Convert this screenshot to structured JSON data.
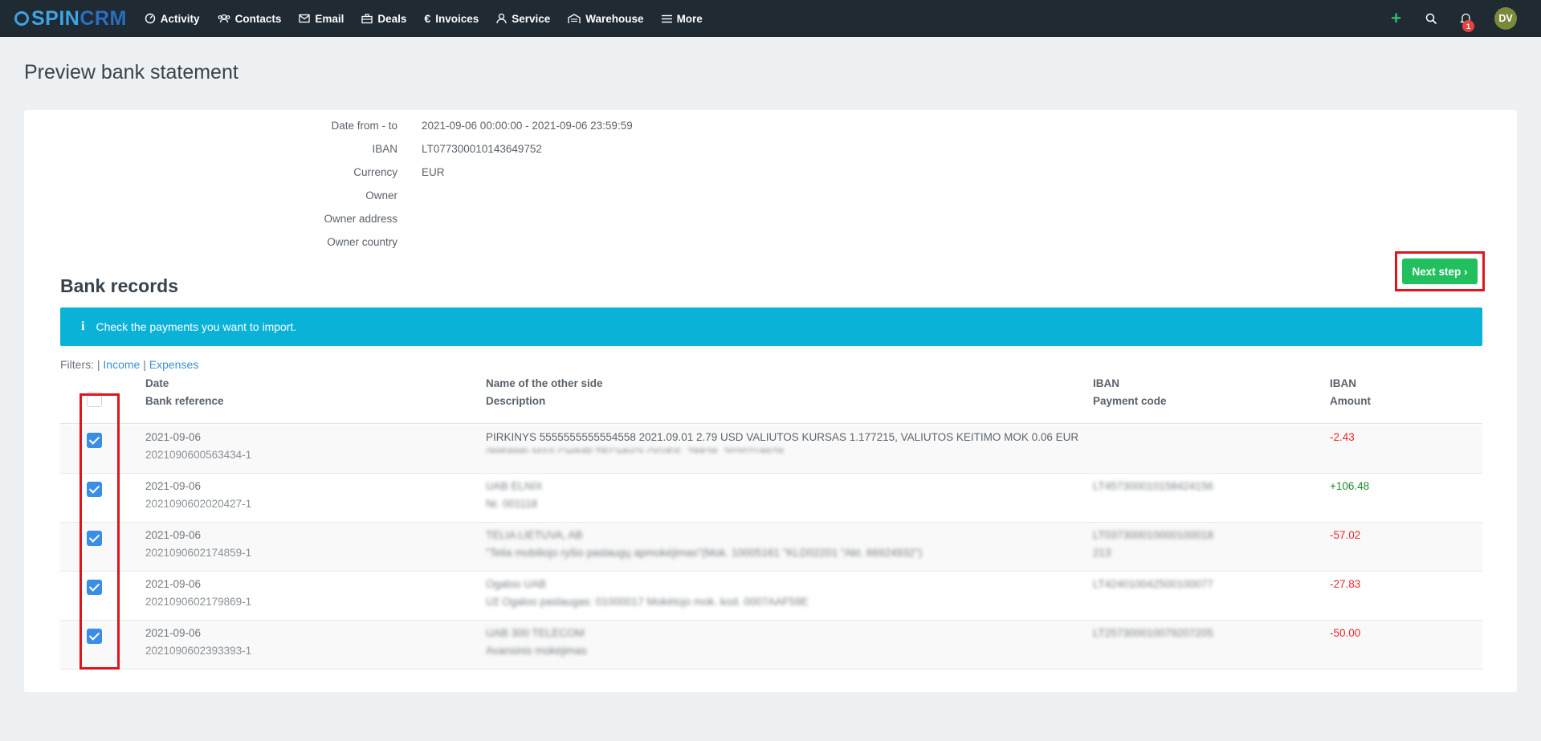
{
  "nav": {
    "brand_spin": "SPIN",
    "brand_crm": "CRM",
    "items": [
      {
        "label": "Activity",
        "icon": "dashboard-icon"
      },
      {
        "label": "Contacts",
        "icon": "contacts-icon"
      },
      {
        "label": "Email",
        "icon": "envelope-icon"
      },
      {
        "label": "Deals",
        "icon": "briefcase-icon"
      },
      {
        "label": "Invoices",
        "icon": "euro-icon"
      },
      {
        "label": "Service",
        "icon": "service-icon"
      },
      {
        "label": "Warehouse",
        "icon": "warehouse-icon"
      },
      {
        "label": "More",
        "icon": "menu-icon"
      }
    ],
    "plus": "+",
    "notification_count": "1",
    "avatar_initials": "DV"
  },
  "page": {
    "title": "Preview bank statement"
  },
  "statement": {
    "date_label": "Date from - to",
    "date_value": "2021-09-06 00:00:00 - 2021-09-06 23:59:59",
    "iban_label": "IBAN",
    "iban_value": "LT077300010143649752",
    "currency_label": "Currency",
    "currency_value": "EUR",
    "owner_label": "Owner",
    "owner_value": "",
    "owner_address_label": "Owner address",
    "owner_address_value": "",
    "owner_country_label": "Owner country",
    "owner_country_value": ""
  },
  "actions": {
    "next_step": "Next step ›"
  },
  "records": {
    "title": "Bank records",
    "alert_icon": "i",
    "alert_text": "Check the payments you want to import.",
    "filters_label": "Filters: |",
    "filter_income": "Income",
    "filter_sep": "|",
    "filter_expenses": "Expenses",
    "headers": {
      "date": "Date",
      "bank_reference": "Bank reference",
      "name": "Name of the other side",
      "description": "Description",
      "iban": "IBAN",
      "payment_code": "Payment code",
      "iban2": "IBAN",
      "amount": "Amount"
    },
    "rows": [
      {
        "checked": true,
        "date": "2021-09-06",
        "reference": "2021090600563434-1",
        "name": "PIRKINYS 5555555555554558 2021.09.01 2.79 USD VALIUTOS KURSAS 1.177215, VALIUTOS KEITIMO MOK 0.06 EUR",
        "description": "(895898) MAILCHIMP TECHNOLOGIES, 78828, 2020718978",
        "iban": "",
        "payment_code": "",
        "amount": "-2.43",
        "sign": "neg"
      },
      {
        "checked": true,
        "date": "2021-09-06",
        "reference": "2021090602020427-1",
        "name": "UAB ELNIX",
        "description": "Nr. 001118",
        "iban": "LT457300010158424156",
        "payment_code": "",
        "amount": "+106.48",
        "sign": "pos"
      },
      {
        "checked": true,
        "date": "2021-09-06",
        "reference": "2021090602174859-1",
        "name": "TELIA LIETUVA, AB",
        "description": "\"Telia mobiliojo ryšio paslaugų apmokėjimas\"(Mok. 10005161 \"KLD02201 \"Akt. 66924932\")",
        "iban": "LT037300010000100018",
        "payment_code": "213",
        "amount": "-57.02",
        "sign": "neg"
      },
      {
        "checked": true,
        "date": "2021-09-06",
        "reference": "2021090602179869-1",
        "name": "Ogaloo UAB",
        "description": "Už Ogaloo paslaugas: 01000017 Mokėtojo mok. kod. 0007AAF59E",
        "iban": "LT424010042500100077",
        "payment_code": "",
        "amount": "-27.83",
        "sign": "neg"
      },
      {
        "checked": true,
        "date": "2021-09-06",
        "reference": "2021090602393393-1",
        "name": "UAB 300 TELECOM",
        "description": "Avansinis mokėjimas",
        "iban": "LT257300010079207205",
        "payment_code": "",
        "amount": "-50.00",
        "sign": "neg"
      }
    ]
  },
  "colors": {
    "nav_bg": "#1f2a33",
    "accent_green": "#22bf5e",
    "alert_cyan": "#0bb2d7",
    "checkbox_blue": "#3a8ee6",
    "highlight_red": "#e0151b",
    "negative": "#e8262b",
    "positive": "#1f8a28"
  }
}
